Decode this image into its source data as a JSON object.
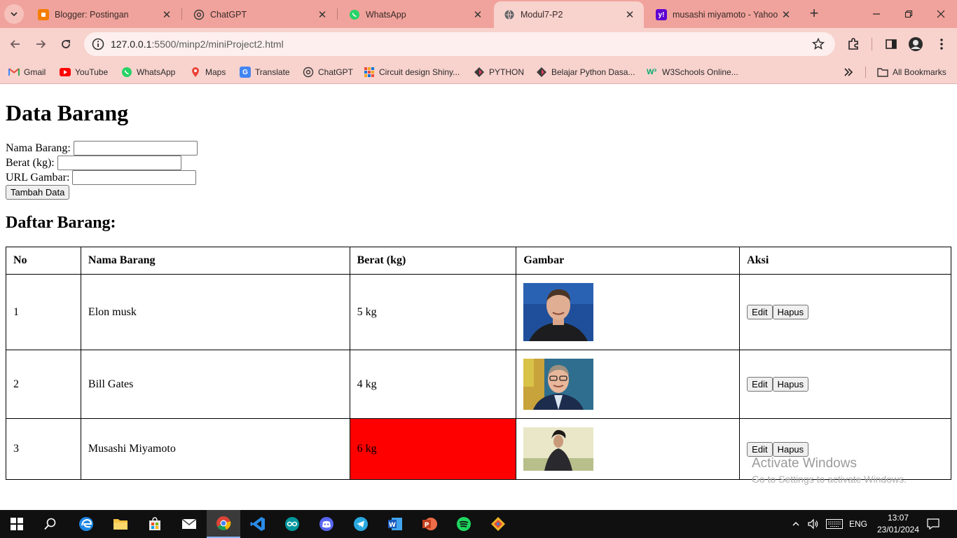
{
  "browser": {
    "tabs": [
      {
        "title": "Blogger: Postingan",
        "icon": "blogger-icon",
        "color": "#f57d00"
      },
      {
        "title": "ChatGPT",
        "icon": "chatgpt-icon",
        "color": "#10a37f"
      },
      {
        "title": "WhatsApp",
        "icon": "whatsapp-icon",
        "color": "#25d366"
      },
      {
        "title": "Modul7-P2",
        "icon": "globe-icon",
        "color": "#5f6368"
      },
      {
        "title": "musashi miyamoto - Yahoo",
        "icon": "yahoo-icon",
        "color": "#6001d2"
      }
    ],
    "active_tab": 3,
    "url_host": "127.0.0.1",
    "url_path": ":5500/minp2/miniProject2.html",
    "bookmarks": [
      {
        "label": "Gmail",
        "icon": "gmail-icon"
      },
      {
        "label": "YouTube",
        "icon": "youtube-icon"
      },
      {
        "label": "WhatsApp",
        "icon": "whatsapp-icon"
      },
      {
        "label": "Maps",
        "icon": "maps-icon"
      },
      {
        "label": "Translate",
        "icon": "translate-icon"
      },
      {
        "label": "ChatGPT",
        "icon": "chatgpt-icon"
      },
      {
        "label": "Circuit design Shiny...",
        "icon": "tinkercad-icon"
      },
      {
        "label": "PYTHON",
        "icon": "python-icon"
      },
      {
        "label": "Belajar Python Dasa...",
        "icon": "python-icon"
      },
      {
        "label": "W3Schools Online...",
        "icon": "w3schools-icon"
      }
    ],
    "all_bookmarks": "All Bookmarks"
  },
  "page": {
    "title": "Data Barang",
    "form": {
      "nama_label": "Nama Barang:",
      "nama_value": "",
      "berat_label": "Berat (kg):",
      "berat_value": "",
      "url_label": "URL Gambar:",
      "url_value": "",
      "submit_label": "Tambah Data"
    },
    "list_title": "Daftar Barang:",
    "table": {
      "headers": [
        "No",
        "Nama Barang",
        "Berat (kg)",
        "Gambar",
        "Aksi"
      ],
      "rows": [
        {
          "no": "1",
          "nama": "Elon musk",
          "berat": "5 kg",
          "image": "elon-musk-photo"
        },
        {
          "no": "2",
          "nama": "Bill Gates",
          "berat": "4 kg",
          "image": "bill-gates-photo"
        },
        {
          "no": "3",
          "nama": "Musashi Miyamoto",
          "berat": "6 kg",
          "image": "musashi-photo",
          "highlight": "#ff0000"
        }
      ],
      "edit_label": "Edit",
      "delete_label": "Hapus"
    }
  },
  "watermark": {
    "line1": "Activate Windows",
    "line2": "Go to Settings to activate Windows."
  },
  "taskbar": {
    "lang": "ENG",
    "time": "13:07",
    "date": "23/01/2024"
  }
}
